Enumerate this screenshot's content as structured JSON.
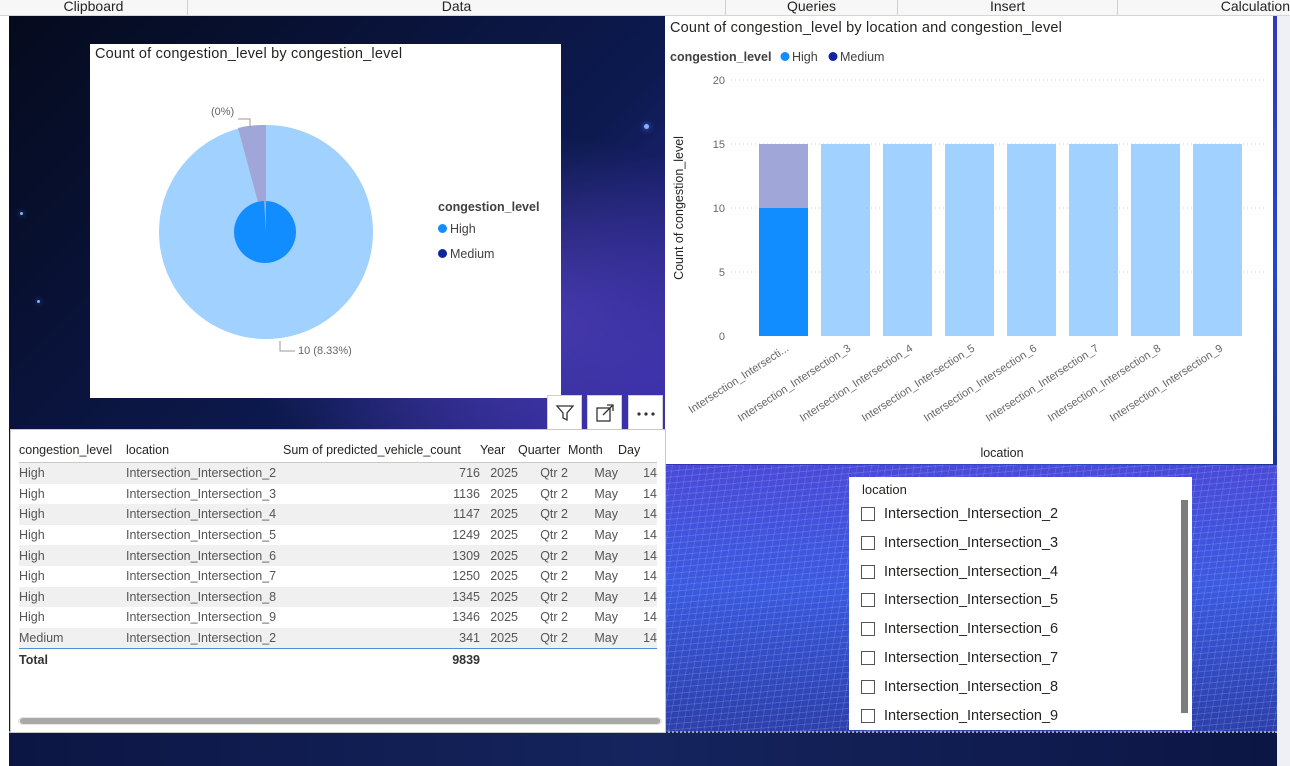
{
  "ribbon": {
    "groups": [
      "Clipboard",
      "Data",
      "Queries",
      "Insert",
      "Calculation"
    ]
  },
  "pie_visual": {
    "title": "Count of congestion_level by congestion_level",
    "legend_title": "congestion_level",
    "legend": [
      "High",
      "Medium"
    ],
    "label_small": "(0%)",
    "label_large": "10 (8.33%)"
  },
  "bar_visual": {
    "title": "Count of congestion_level by location and congestion_level"
  },
  "visual_buttons": {
    "filter_icon": "filter-icon",
    "focus_icon": "focus-mode-icon",
    "more_icon": "more-options-icon"
  },
  "table": {
    "columns": [
      "congestion_level",
      "location",
      "Sum of predicted_vehicle_count",
      "Year",
      "Quarter",
      "Month",
      "Day"
    ],
    "rows": [
      [
        "High",
        "Intersection_Intersection_2",
        "716",
        "2025",
        "Qtr 2",
        "May",
        "14"
      ],
      [
        "High",
        "Intersection_Intersection_3",
        "1136",
        "2025",
        "Qtr 2",
        "May",
        "14"
      ],
      [
        "High",
        "Intersection_Intersection_4",
        "1147",
        "2025",
        "Qtr 2",
        "May",
        "14"
      ],
      [
        "High",
        "Intersection_Intersection_5",
        "1249",
        "2025",
        "Qtr 2",
        "May",
        "14"
      ],
      [
        "High",
        "Intersection_Intersection_6",
        "1309",
        "2025",
        "Qtr 2",
        "May",
        "14"
      ],
      [
        "High",
        "Intersection_Intersection_7",
        "1250",
        "2025",
        "Qtr 2",
        "May",
        "14"
      ],
      [
        "High",
        "Intersection_Intersection_8",
        "1345",
        "2025",
        "Qtr 2",
        "May",
        "14"
      ],
      [
        "High",
        "Intersection_Intersection_9",
        "1346",
        "2025",
        "Qtr 2",
        "May",
        "14"
      ],
      [
        "Medium",
        "Intersection_Intersection_2",
        "341",
        "2025",
        "Qtr 2",
        "May",
        "14"
      ]
    ],
    "total_label": "Total",
    "total_value": "9839"
  },
  "slicer": {
    "title": "location",
    "items": [
      "Intersection_Intersection_2",
      "Intersection_Intersection_3",
      "Intersection_Intersection_4",
      "Intersection_Intersection_5",
      "Intersection_Intersection_6",
      "Intersection_Intersection_7",
      "Intersection_Intersection_8",
      "Intersection_Intersection_9"
    ]
  },
  "colors": {
    "high": "#118DFF",
    "medium": "#12239E",
    "high_dim": "#A0D1FF",
    "medium_dim": "#A0A7D8"
  },
  "chart_data": [
    {
      "type": "pie",
      "title": "Count of congestion_level by congestion_level",
      "legend_title": "congestion_level",
      "legend_position": "right",
      "categories": [
        "High",
        "Medium"
      ],
      "values": [
        110,
        10
      ],
      "labels": [
        "(0%)",
        "10 (8.33%)"
      ]
    },
    {
      "type": "bar",
      "stacked": true,
      "title": "Count of congestion_level by location and congestion_level",
      "xlabel": "location",
      "ylabel": "Count of congestion_level",
      "legend_title": "congestion_level",
      "legend_position": "top-left",
      "ylim": [
        0,
        20
      ],
      "yticks": [
        "0",
        "5",
        "10",
        "15",
        "20"
      ],
      "grid": true,
      "categories": [
        "Intersection_Intersecti...",
        "Intersection_Intersection_3",
        "Intersection_Intersection_4",
        "Intersection_Intersection_5",
        "Intersection_Intersection_6",
        "Intersection_Intersection_7",
        "Intersection_Intersection_8",
        "Intersection_Intersection_9"
      ],
      "series": [
        {
          "name": "High",
          "values": [
            10,
            15,
            15,
            15,
            15,
            15,
            15,
            15
          ]
        },
        {
          "name": "Medium",
          "values": [
            5,
            0,
            0,
            0,
            0,
            0,
            0,
            0
          ]
        }
      ]
    }
  ]
}
